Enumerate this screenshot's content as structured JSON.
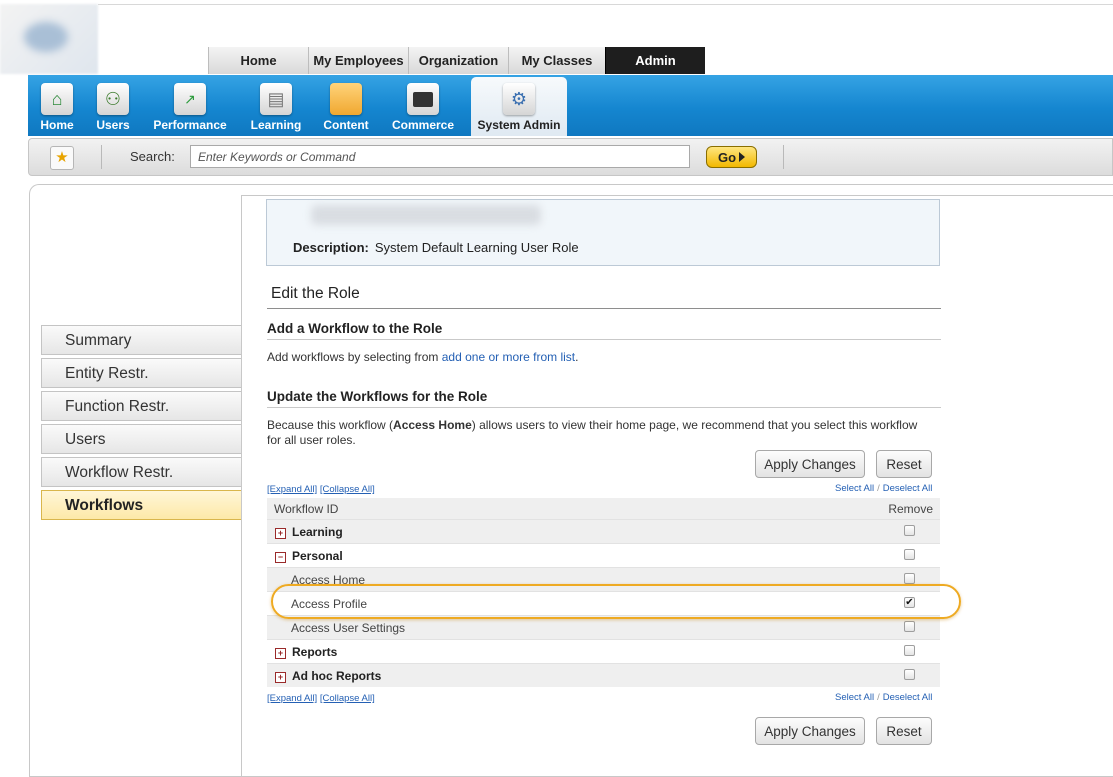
{
  "top_tabs": [
    {
      "label": "Home",
      "active": false
    },
    {
      "label": "My Employees",
      "active": false
    },
    {
      "label": "Organization",
      "active": false
    },
    {
      "label": "My Classes",
      "active": false
    },
    {
      "label": "Admin",
      "active": true
    }
  ],
  "icon_bar": [
    {
      "label": "Home",
      "icon": "home-icon",
      "active": false
    },
    {
      "label": "Users",
      "icon": "users-icon",
      "active": false
    },
    {
      "label": "Performance",
      "icon": "performance-chart-icon",
      "active": false
    },
    {
      "label": "Learning",
      "icon": "document-icon",
      "active": false
    },
    {
      "label": "Content",
      "icon": "folder-icon",
      "active": false
    },
    {
      "label": "Commerce",
      "icon": "briefcase-icon",
      "active": false
    },
    {
      "label": "System Admin",
      "icon": "system-admin-icon",
      "active": true
    }
  ],
  "search": {
    "label": "Search:",
    "placeholder": "Enter Keywords or Command",
    "go_label": "Go"
  },
  "left_nav": [
    {
      "label": "Summary",
      "active": false
    },
    {
      "label": "Entity Restr.",
      "active": false
    },
    {
      "label": "Function Restr.",
      "active": false
    },
    {
      "label": "Users",
      "active": false
    },
    {
      "label": "Workflow Restr.",
      "active": false
    },
    {
      "label": "Workflows",
      "active": true
    }
  ],
  "role_info": {
    "description_label": "Description:",
    "description_value": "System Default Learning User Role"
  },
  "edit_heading": "Edit the Role",
  "add_section": {
    "heading": "Add a Workflow to the Role",
    "text": "Add workflows by selecting from",
    "link": "add one or more from list",
    "suffix": "."
  },
  "update_section": {
    "heading": "Update the Workflows for the Role",
    "note_prefix": "Because this workflow (",
    "note_bold": "Access Home",
    "note_suffix": ") allows users to view their home page, we recommend that you select this workflow for all user roles."
  },
  "buttons": {
    "apply": "Apply Changes",
    "reset": "Reset"
  },
  "links": {
    "expand_all": "[Expand All]",
    "collapse_all": "[Collapse All]",
    "select_all": "Select All",
    "deselect_all": "Deselect All",
    "slash": "/"
  },
  "table": {
    "col_id": "Workflow ID",
    "col_remove": "Remove",
    "rows": [
      {
        "label": "Learning",
        "type": "group",
        "expanded": false,
        "checked": false
      },
      {
        "label": "Personal",
        "type": "group",
        "expanded": true,
        "checked": false
      },
      {
        "label": "Access Home",
        "type": "child",
        "checked": false
      },
      {
        "label": "Access Profile",
        "type": "child",
        "checked": true
      },
      {
        "label": "Access User Settings",
        "type": "child",
        "checked": false
      },
      {
        "label": "Reports",
        "type": "group",
        "expanded": false,
        "checked": false
      },
      {
        "label": "Ad hoc Reports",
        "type": "group",
        "expanded": false,
        "checked": false
      }
    ]
  },
  "colors": {
    "icon_bar_blue": "#1586d0",
    "highlight_orange": "#eeaa22",
    "link_blue": "#2460b4",
    "active_nav_yellow": "#fde9a8"
  }
}
